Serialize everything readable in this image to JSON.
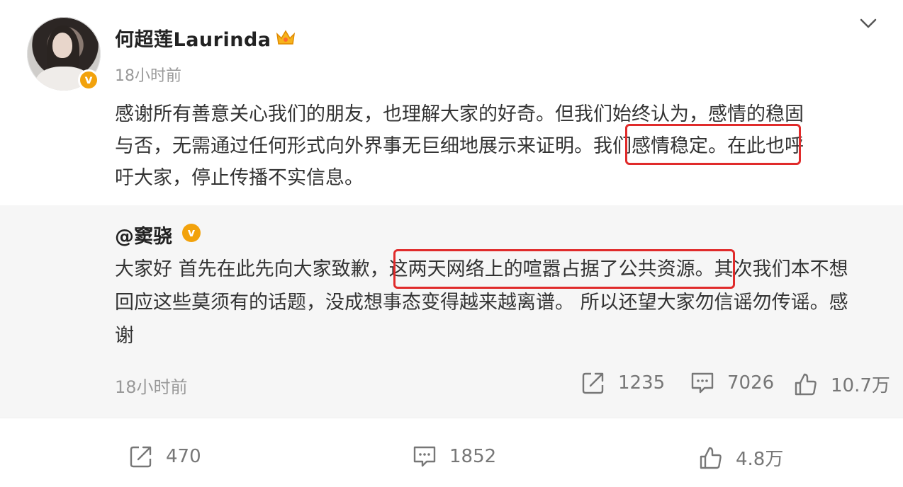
{
  "post": {
    "user_name": "何超莲Laurinda",
    "time": "18小时前",
    "text_lines": [
      "感谢所有善意关心我们的朋友，也理解大家的好奇。但我们始终认为，感情的稳固",
      "与否，无需通过任何形式向外界事无巨细地展示来证明。我们感情稳定。在此也呼",
      "吁大家，停止传播不实信息。"
    ]
  },
  "quote": {
    "user_name": "@窦骁",
    "text_lines": [
      "大家好 首先在此先向大家致歉，这两天网络上的喧嚣占据了公共资源。其次我们本不想",
      "回应这些莫须有的话题，没成想事态变得越来越离谱。 所以还望大家勿信谣勿传谣。感",
      "谢"
    ],
    "time": "18小时前",
    "repost_count": "1235",
    "comment_count": "7026",
    "like_count": "10.7万"
  },
  "actions": {
    "repost_count": "470",
    "comment_count": "1852",
    "like_count": "4.8万"
  },
  "colors": {
    "highlight": "#e02b2b",
    "verified": "#f2a20c",
    "quote_bg": "#f6f6f6"
  },
  "icons": {
    "verified": "verified-icon",
    "crown": "crown-icon",
    "expand": "chevron-down-icon",
    "repost": "repost-icon",
    "comment": "comment-icon",
    "like": "like-icon"
  }
}
